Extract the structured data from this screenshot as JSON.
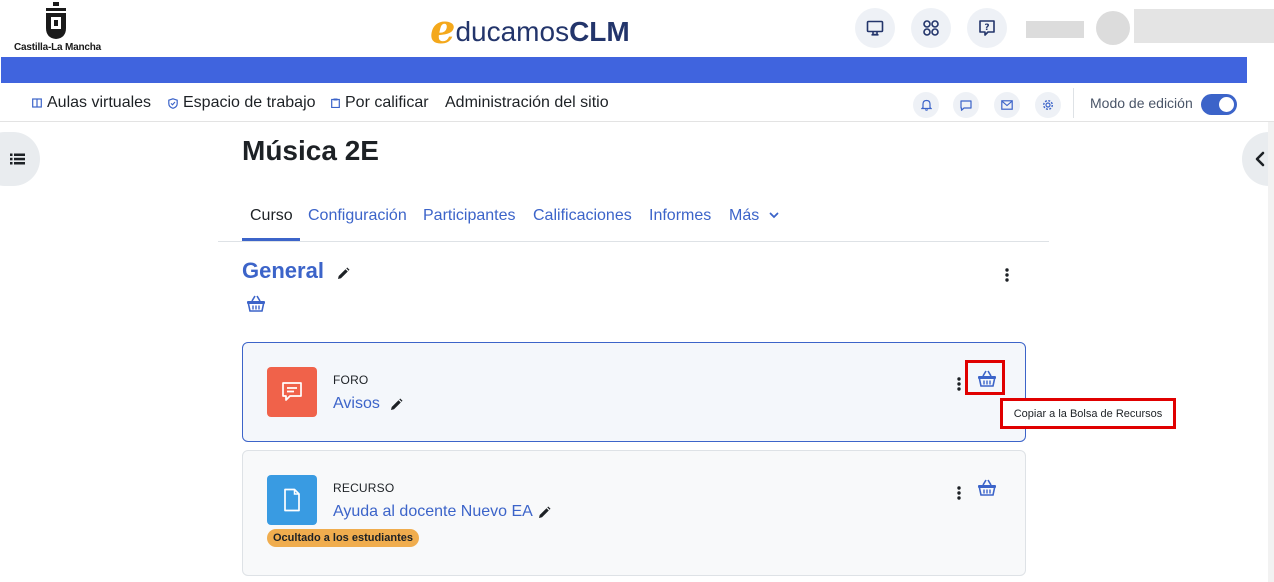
{
  "header": {
    "logo_text": "Castilla-La Mancha",
    "brand_e": "e",
    "brand_ducamos": "ducamos",
    "brand_clm": "CLM",
    "icons": [
      "monitor-icon",
      "apps-grid-icon",
      "help-icon"
    ]
  },
  "nav": {
    "aulas": "Aulas virtuales",
    "espacio": "Espacio de trabajo",
    "calificar": "Por calificar",
    "admin": "Administración del sitio",
    "edit_mode_label": "Modo de edición",
    "edit_mode_on": true
  },
  "course": {
    "title": "Música 2E",
    "tabs": [
      {
        "label": "Curso",
        "active": true
      },
      {
        "label": "Configuración"
      },
      {
        "label": "Participantes"
      },
      {
        "label": "Calificaciones"
      },
      {
        "label": "Informes"
      },
      {
        "label": "Más"
      }
    ],
    "section": "General",
    "activities": [
      {
        "type": "FORO",
        "name": "Avisos",
        "icon": "forum-icon"
      },
      {
        "type": "RECURSO",
        "name": "Ayuda al docente Nuevo EA",
        "icon": "file-icon",
        "badge": "Ocultado a los estudiantes"
      }
    ]
  },
  "tooltip": {
    "text": "Copiar a la Bolsa de Recursos"
  },
  "colors": {
    "accent": "#3c64c9",
    "bluebar": "#4064de",
    "forum": "#f0624a",
    "resource": "#399be2",
    "badge": "#f0ad4e",
    "highlight": "#e00000"
  }
}
